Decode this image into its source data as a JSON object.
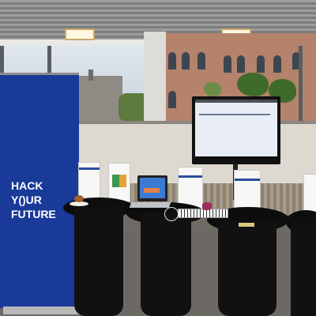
{
  "banner": {
    "logo_lines": [
      "HACK",
      "Y()UR",
      "FUTURE"
    ]
  },
  "colors": {
    "banner_blue": "#1a3a9a",
    "table_black": "#111111",
    "brick": "#b5826c",
    "wall": "#ddd9d1"
  }
}
